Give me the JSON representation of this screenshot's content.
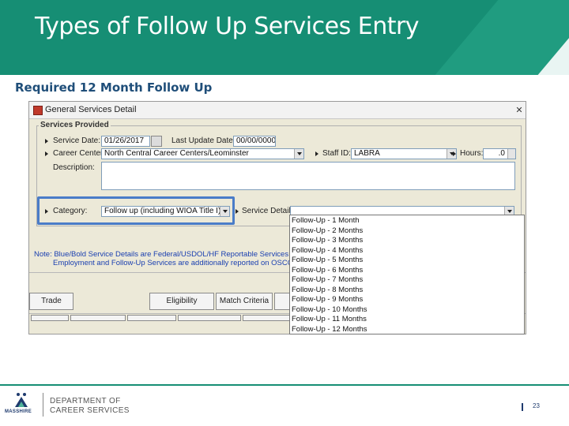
{
  "slide": {
    "title": "Types of Follow Up Services Entry",
    "subtitle": "Required 12 Month Follow Up",
    "page_number": "23"
  },
  "window": {
    "title": "General Services Detail",
    "group_title": "Services Provided",
    "labels": {
      "service_date": "Service Date:",
      "last_update_date": "Last Update Date:",
      "career_center": "Career Center:",
      "staff_id": "Staff ID:",
      "hours": "Hours:",
      "description": "Description:",
      "category": "Category:",
      "service_detail": "Service Detail:"
    },
    "values": {
      "service_date": "01/26/2017",
      "last_update_date": "00/00/0000",
      "career_center": "North Central Career Centers/Leominster",
      "staff_id": "LABRA",
      "hours": ".0",
      "category": "Follow up (including WIOA Title I)"
    },
    "note_line1": "Note: Blue/Bold Service Details are Federal/USDOL/HF Reportable Services",
    "note_line2": "Employment and Follow-Up Services are additionally reported on OSCCAR",
    "buttons": {
      "trade": "Trade",
      "eligibility": "Eligibility",
      "match_criteria": "Match Criteria"
    }
  },
  "dropdown_options": [
    "Follow-Up - 1 Month",
    "Follow-Up - 2 Months",
    "Follow-Up - 3 Months",
    "Follow-Up - 4 Months",
    "Follow-Up - 5 Months",
    "Follow-Up - 6 Months",
    "Follow-Up - 7 Months",
    "Follow-Up - 8 Months",
    "Follow-Up - 9 Months",
    "Follow-Up - 10 Months",
    "Follow-Up - 11 Months",
    "Follow-Up - 12 Months"
  ],
  "footer": {
    "logo_text": "MASSHIRE",
    "dept_line1": "DEPARTMENT OF",
    "dept_line2": "CAREER SERVICES"
  },
  "colors": {
    "header": "#168e74",
    "highlight": "#4a7cc8",
    "note_text": "#1a3fb0",
    "subtitle": "#1f4e79"
  }
}
